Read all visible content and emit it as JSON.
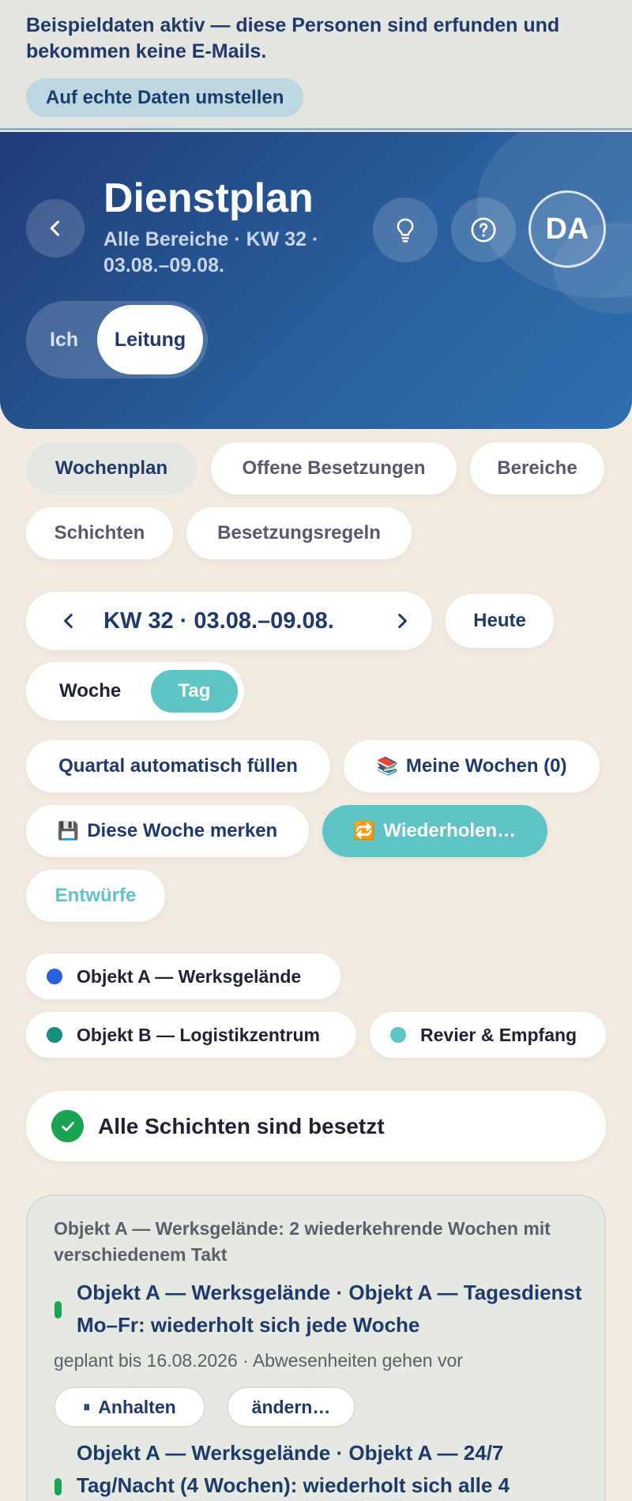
{
  "demo_banner": {
    "text": "Beispieldaten aktiv — diese Personen sind erfunden und bekommen keine E-Mails.",
    "button_label": "Auf echte Daten umstellen"
  },
  "header": {
    "title": "Dienstplan",
    "subtitle": "Alle Bereiche · KW 32 · 03.08.–09.08.",
    "avatar_initials": "DA",
    "icons": [
      "chevron-left-icon",
      "lightbulb-icon",
      "help-circle-icon"
    ],
    "role_toggle": {
      "options": [
        "Ich",
        "Leitung"
      ],
      "selected": "Leitung"
    }
  },
  "tabs": {
    "items": [
      "Wochenplan",
      "Offene Besetzungen",
      "Bereiche",
      "Schichten",
      "Besetzungsregeln"
    ],
    "active": "Wochenplan"
  },
  "week_nav": {
    "label": "KW 32 · 03.08.–09.08.",
    "today_label": "Heute"
  },
  "view_toggle": {
    "options": [
      "Woche",
      "Tag"
    ],
    "selected": "Tag"
  },
  "actions": {
    "auto_fill": "Quartal automatisch füllen",
    "my_weeks": "Meine Wochen (0)",
    "remember_week": "Diese Woche merken",
    "repeat": "Wiederholen…",
    "drafts": "Entwürfe"
  },
  "legend": [
    {
      "label": "Objekt A — Werksgelände",
      "color": "#2c5fde"
    },
    {
      "label": "Objekt B — Logistikzentrum",
      "color": "#15907f"
    },
    {
      "label": "Revier & Empfang",
      "color": "#5fc4c6"
    }
  ],
  "status": {
    "text": "Alle Schichten sind besetzt"
  },
  "recurring": {
    "title": "Objekt A — Werksgelände: 2 wiederkehrende Wochen mit verschiedenem Takt",
    "items": [
      {
        "title": "Objekt A — Werksgelände · Objekt A — Tagesdienst Mo–Fr: wiederholt sich jede Woche",
        "meta": "geplant bis 16.08.2026 · Abwesenheiten gehen vor",
        "pause_label": "Anhalten",
        "edit_label": "ändern…"
      },
      {
        "title": "Objekt A — Werksgelände · Objekt A — 24/7 Tag/Nacht (4 Wochen): wiederholt sich alle 4"
      }
    ]
  },
  "colors": {
    "accent_teal": "#5fc4c6",
    "navy": "#1f3a6a",
    "success": "#1aa352",
    "background": "#f2ece2"
  }
}
